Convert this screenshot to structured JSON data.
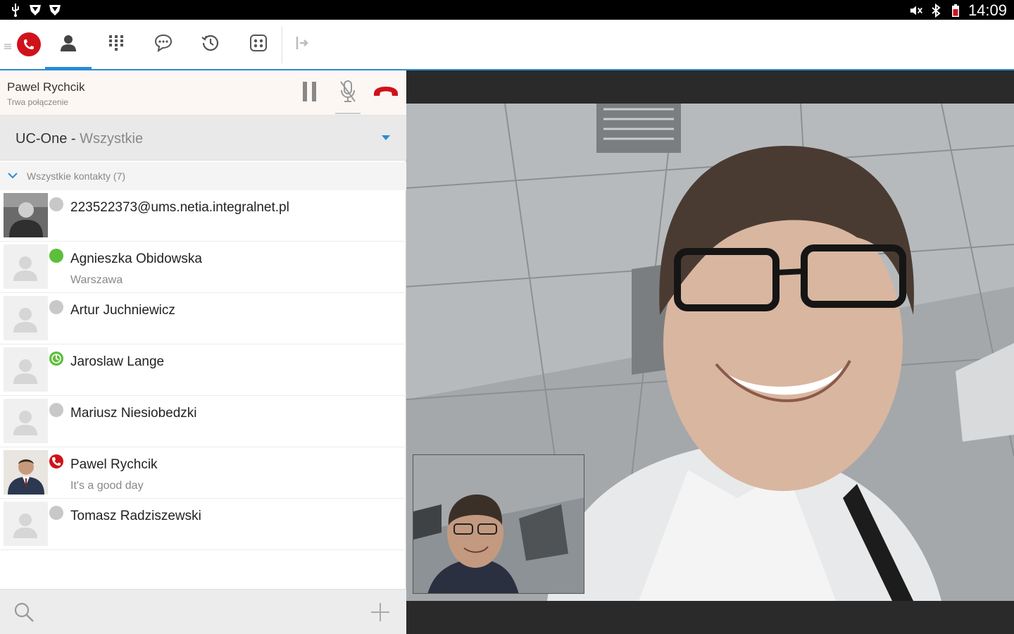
{
  "statusbar": {
    "time": "14:09",
    "left_icons": [
      "usb-icon",
      "shield-icon",
      "shield-icon"
    ],
    "right_icons": [
      "mute-icon",
      "bluetooth-icon",
      "battery-icon"
    ]
  },
  "toolbar": {
    "items": [
      {
        "name": "call-status",
        "icon": "phone-icon"
      },
      {
        "name": "contacts",
        "icon": "person-icon",
        "active": true
      },
      {
        "name": "dialpad",
        "icon": "dialpad-icon"
      },
      {
        "name": "chat",
        "icon": "chat-icon"
      },
      {
        "name": "history",
        "icon": "history-icon"
      },
      {
        "name": "conference",
        "icon": "conference-icon"
      },
      {
        "name": "collapse",
        "icon": "collapse-icon"
      }
    ]
  },
  "active_call": {
    "name": "Pawel Rychcik",
    "status": "Trwa połączenie"
  },
  "source": {
    "prefix": "UC-One - ",
    "value": "Wszystkie"
  },
  "group": {
    "label": "Wszystkie kontakty (7)"
  },
  "contacts": [
    {
      "name": "223522373@ums.netia.integralnet.pl",
      "sub": "",
      "presence": "offline",
      "photo": true
    },
    {
      "name": "Agnieszka Obidowska",
      "sub": "Warszawa",
      "presence": "available",
      "photo": false
    },
    {
      "name": "Artur Juchniewicz",
      "sub": "",
      "presence": "offline",
      "photo": false
    },
    {
      "name": "Jaroslaw Lange",
      "sub": "",
      "presence": "idle",
      "photo": false
    },
    {
      "name": "Mariusz Niesiobedzki",
      "sub": "",
      "presence": "offline",
      "photo": false
    },
    {
      "name": "Pawel Rychcik",
      "sub": "It's a good day",
      "presence": "oncall",
      "photo": true
    },
    {
      "name": "Tomasz Radziszewski",
      "sub": "",
      "presence": "offline",
      "photo": false
    }
  ],
  "colors": {
    "accent": "#2b8bd6",
    "hangup": "#d0121b",
    "available": "#5cbf3a",
    "offline": "#c8c8c8"
  }
}
